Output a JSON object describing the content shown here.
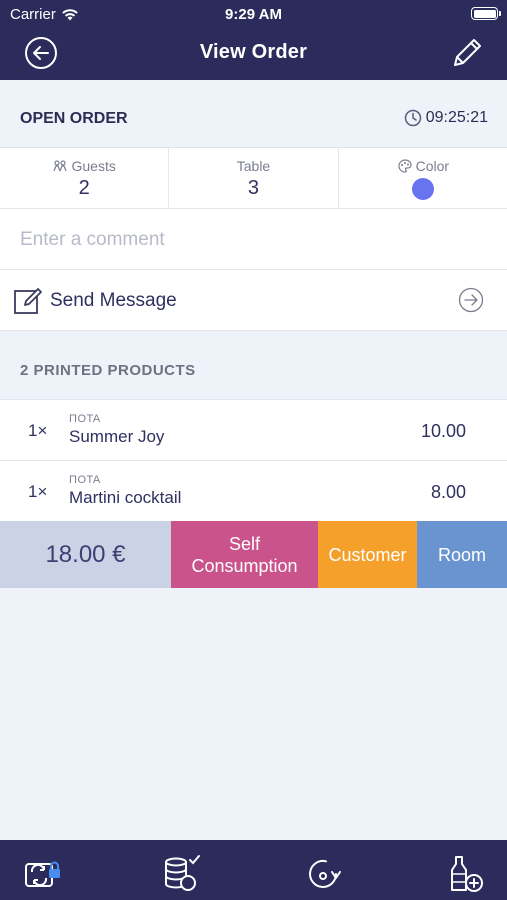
{
  "status_bar": {
    "carrier": "Carrier",
    "time": "9:29 AM"
  },
  "nav": {
    "title": "View Order",
    "back_icon": "back-arrow-icon",
    "edit_icon": "pencil-icon"
  },
  "order": {
    "status": "OPEN ORDER",
    "time": "09:25:21"
  },
  "info": {
    "guests_label": "Guests",
    "guests_value": "2",
    "table_label": "Table",
    "table_value": "3",
    "color_label": "Color",
    "color_value": "#6873f0"
  },
  "comment": {
    "placeholder": "Enter a comment",
    "value": ""
  },
  "message": {
    "label": "Send Message"
  },
  "products": {
    "title": "2 PRINTED PRODUCTS",
    "items": [
      {
        "qty": "1×",
        "category": "ΠΟΤΑ",
        "name": "Summer Joy",
        "price": "10.00"
      },
      {
        "qty": "1×",
        "category": "ΠΟΤΑ",
        "name": "Martini cocktail",
        "price": "8.00"
      }
    ]
  },
  "actions": {
    "total": "18.00 €",
    "self_line1": "Self",
    "self_line2": "Consumption",
    "customer": "Customer",
    "room": "Room"
  },
  "colors": {
    "header_bg": "#2b2b5c",
    "self": "#c9538a",
    "customer": "#f6a02c",
    "room": "#6a94cf",
    "total_bg": "#ccd2e5"
  },
  "tabbar": {
    "icons": [
      "locked-transfer-icon",
      "coins-check-icon",
      "rotate-icon",
      "bottle-add-icon"
    ]
  }
}
